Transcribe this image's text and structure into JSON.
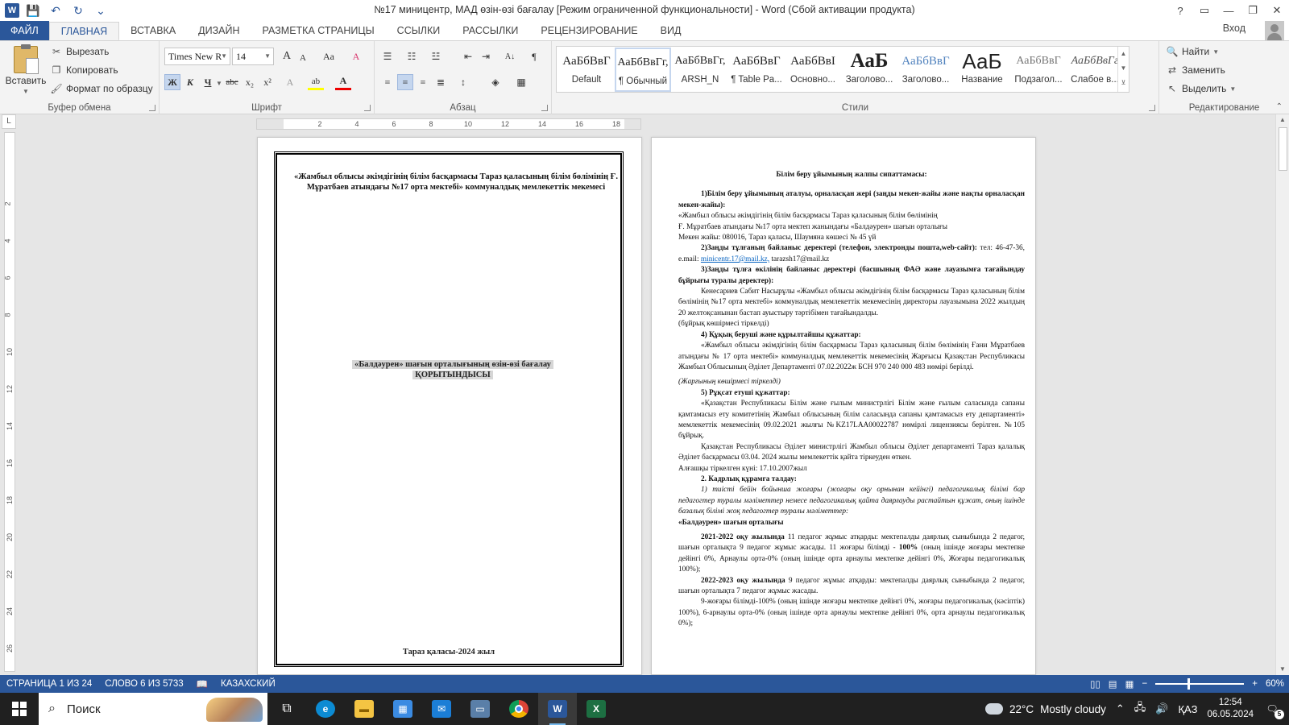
{
  "window": {
    "title": "№17 миницентр, МАД өзін-өзі бағалау [Режим ограниченной функциональности] - Word (Сбой активации продукта)",
    "help": "?",
    "minimize": "—",
    "restore": "❐",
    "close": "✕"
  },
  "qat": {
    "word": "W",
    "save": "💾",
    "undo": "↶",
    "redo": "↻",
    "customize": "⌄"
  },
  "tabs": [
    "ФАЙЛ",
    "ГЛАВНАЯ",
    "ВСТАВКА",
    "ДИЗАЙН",
    "РАЗМЕТКА СТРАНИЦЫ",
    "ССЫЛКИ",
    "РАССЫЛКИ",
    "РЕЦЕНЗИРОВАНИЕ",
    "ВИД"
  ],
  "signin": "Вход",
  "ribbon": {
    "clipboard": {
      "label": "Буфер обмена",
      "paste": "Вставить",
      "cut": "Вырезать",
      "copy": "Копировать",
      "format_painter": "Формат по образцу"
    },
    "font": {
      "label": "Шрифт",
      "name": "Times New R",
      "size": "14",
      "grow": "A",
      "shrink": "A",
      "case": "Aa",
      "clear": "A",
      "bold": "Ж",
      "italic": "К",
      "underline": "Ч",
      "strike": "abc",
      "sub": "x₂",
      "sup": "x²",
      "effects": "A",
      "highlight": "ab",
      "color": "A"
    },
    "paragraph": {
      "label": "Абзац",
      "sort": "A↓",
      "marks": "¶"
    },
    "styles": {
      "label": "Стили",
      "items": [
        {
          "preview": "АаБбВвГ",
          "name": "Default"
        },
        {
          "preview": "АаБбВвГг,",
          "name": "¶ Обычный"
        },
        {
          "preview": "АаБбВвГг,",
          "name": "ARSH_N"
        },
        {
          "preview": "АаБбВвГ",
          "name": "¶ Table Pa..."
        },
        {
          "preview": "АаБбВвІ",
          "name": "Основно..."
        },
        {
          "preview": "АаБ",
          "name": "Заголово..."
        },
        {
          "preview": "АаБбВвГ",
          "name": "Заголово..."
        },
        {
          "preview": "АаБ",
          "name": "Название"
        },
        {
          "preview": "АаБбВвГ",
          "name": "Подзагол..."
        },
        {
          "preview": "АаБбВвГг",
          "name": "Слабое в..."
        }
      ]
    },
    "editing": {
      "label": "Редактирование",
      "find": "Найти",
      "replace": "Заменить",
      "select": "Выделить"
    }
  },
  "ruler": {
    "h": [
      "2",
      "4",
      "6",
      "8",
      "10",
      "12",
      "14",
      "16",
      "18"
    ],
    "v": [
      "2",
      "4",
      "6",
      "8",
      "10",
      "12",
      "14",
      "16",
      "18",
      "20",
      "22",
      "24",
      "26"
    ],
    "corner": "L"
  },
  "page1": {
    "header": "«Жамбыл облысы әкімдігінің білім басқармасы Тараз қаласының білім бөлімінің Ғ. Мұратбаев атындағы №17 орта мектебі» коммуналдық мемлекеттік мекемесі",
    "title1": "«Балдәурен» шағын орталығының өзін-өзі бағалау",
    "title2": "ҚОРЫТЫНДЫСЫ",
    "footer": "Тараз қаласы-2024 жыл"
  },
  "page2": {
    "heading": "Білім беру ұйымының жалпы сипаттамасы:",
    "s1_title": "1)Білім беру ұйымының аталуы, орналасқан жері (заңды мекен-жайы және нақты орналасқан мекен-жайы):",
    "s1_a": "«Жамбыл облысы әкімдігінің білім басқармасы Тараз қаласының білім бөлімінің",
    "s1_b": "Ғ. Мұратбаев атындағы №17 орта мектеп жанындағы «Балдәурен» шағын орталығы",
    "s1_c": "Мекен жайы: 080016, Тараз қаласы, Шаумяна көшесі № 45 үй",
    "s2_title": "2)Заңды тұлғаның байланыс деректері (телефон, электронды пошта,web-сайт):",
    "s2_phone": "тел: 46-47-36, e.mail:",
    "s2_link": "minicentr.17@mail.kz,",
    "s2_mail2": "tarazsh17@mail.kz",
    "s3_title": "3)Заңды тұлға өкілінің байланыс деректері (басшының ФАӘ және лауазымға тағайындау бұйрығы туралы деректер):",
    "s3_text": "Кенесариев Сабит Насырұлы «Жамбыл облысы әкімдігінің білім басқармасы Тараз қаласының білім бөлімінің №17 орта мектебі» коммуналдық мемлекеттік мекемесінің директоры лауазымына 2022 жылдың 20 желтоқсанынан бастап ауыстыру тәртібімен тағайындалды.",
    "s3_note": "(бұйрық көшірмесі тіркелді)",
    "s4_title": "4) Құқық беруші және құрылтайшы құжаттар:",
    "s4_text": "«Жамбыл облысы әкімдігінің білім басқармасы Тараз қаласының білім бөлімінің Ғани Мұратбаев атындағы № 17 орта мектебі» коммуналдық мемлекеттік мекемесінің Жарғысы Қазақстан Республикасы Жамбыл Облысының Әділет Департаменті 07.02.2022ж БСН 970 240 000 483 нөмірі берілді.",
    "s4_note": "(Жарғының көшірмесі тіркелді)",
    "s5_title": "5) Рұқсат етуші құжаттар:",
    "s5_text1": "«Қазақстан Республикасы Білім және ғылым министрлігі Білім және ғылым саласында сапаны қамтамасыз ету комитетінің Жамбыл облысының білім саласында сапаны қамтамасыз ету департаменті» мемлекеттік мекемесінің 09.02.2021 жылғы №KZ17LAA00022787 нөмірлі лицензиясы берілген. №105 бұйрық.",
    "s5_text2": "Қазақстан Республикасы Әділет министрлігі Жамбыл облысы Әділет департаменті Тараз қалалық Әділет басқармасы 03.04. 2024 жылы мемлекеттік қайта тіркеуден өткен.",
    "s5_text3": "Алғашқы тіркелген күні: 17.10.2007жыл",
    "k_title": "2. Кадрлық құрамға талдау:",
    "k_text": "1) тиісті бейін бойынша жоғары (жоғары оқу орнынан кейінгі) педагогикалық білімі бар педагогтер туралы мәліметтер немесе педагогикалық қайта даярлауды растайтын құжат, оның ішінде базалық білімі жоқ педагогтер туралы мәліметтер:",
    "k_center": "«Балдәурен» шағын орталығы",
    "y1_year": "2021-2022 оқу жылында",
    "y1_text": "11 педагог жұмыс атқарды: мектепалды даярлық сыныбында 2 педагог, шағын орталықта 9 педагог жұмыс жасады. 11 жоғары білімді -",
    "y1_pct": "100%",
    "y1_rest": "(оның ішінде жоғары мектепке дейінгі 0%, Арнаулы орта-0% (оның ішінде орта арнаулы мектепке дейінгі 0%, Жоғары педагогикалық 100%);",
    "y2_year": "2022-2023 оқу жылында",
    "y2_text": "9 педагог жұмыс атқарды: мектепалды даярлық сыныбында 2 педагог, шағын орталықта 7 педагог жұмыс жасады.",
    "y3_text": "9-жоғары білімді-100% (оның ішінде жоғары мектепке дейінгі 0%, жоғары педагогикалық (кәсіптік) 100%), 6-арнаулы орта-0% (оның ішінде орта арнаулы мектепке дейінгі 0%, орта арнаулы педагогикалық 0%);"
  },
  "status": {
    "page": "СТРАНИЦА 1 ИЗ 24",
    "words": "СЛОВО 6 ИЗ 5733",
    "language": "КАЗАХСКИЙ",
    "zoom": "60%"
  },
  "taskbar": {
    "search": "Поиск",
    "temp": "22°C",
    "weather": "Mostly cloudy",
    "lang": "ҚАЗ",
    "time": "12:54",
    "date": "06.05.2024",
    "notifications": "5"
  },
  "colors": {
    "word_blue": "#2b579a",
    "excel_green": "#1d6f42",
    "taskbar": "#202020"
  }
}
